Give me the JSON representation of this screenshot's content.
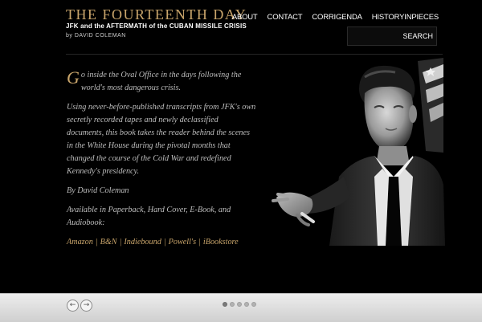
{
  "header": {
    "title": "THE FOURTEENTH DAY",
    "subtitle": "JFK and the AFTERMATH of the CUBAN MISSILE CRISIS",
    "byline": "by DAVID COLEMAN"
  },
  "nav": {
    "items": [
      "ABOUT",
      "CONTACT",
      "CORRIGENDA",
      "HISTORYINPIECES"
    ]
  },
  "search": {
    "button_label": "SEARCH",
    "value": ""
  },
  "content": {
    "dropcap": "G",
    "intro": "o inside the Oval Office in the days following the world's most dangerous crisis.",
    "description": "Using never-before-published transcripts from JFK's own secretly recorded tapes and newly declassified documents, this book takes the reader behind the scenes in the White House during the pivotal months that changed the course of the Cold War and redefined Kennedy's presidency.",
    "author": "By David Coleman",
    "availability": "Available in Paperback, Hard Cover, E-Book, and Audiobook:",
    "links": [
      "Amazon",
      "B&N",
      "Indiebound",
      "Powell's",
      "iBookstore"
    ],
    "link_separator": "|"
  },
  "footer": {
    "prev_icon": "arrow-left-circle-icon",
    "next_icon": "arrow-right-circle-icon",
    "slides_total": 5,
    "active_slide": 1
  },
  "colors": {
    "background": "#000000",
    "gold_accent": "#c9a56b",
    "body_text": "#bdbdbd",
    "footer_bar": "#dcdcdc"
  }
}
